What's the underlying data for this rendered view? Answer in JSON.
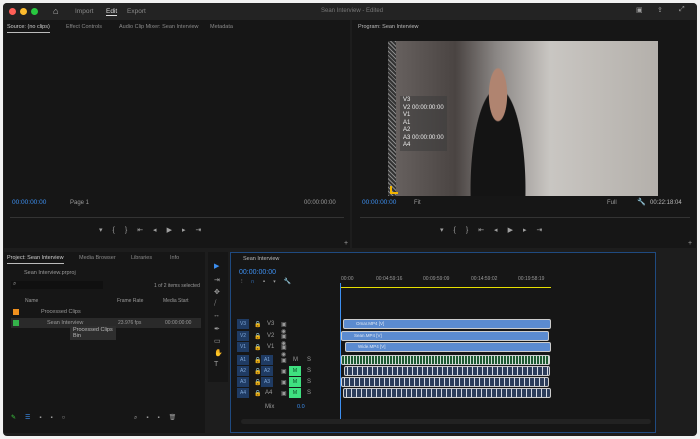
{
  "app": {
    "title": "Sean Interview - Edited",
    "nav": [
      "Import",
      "Edit",
      "Export"
    ],
    "active_nav": "Edit"
  },
  "colors": {
    "accent": "#3d8ff0",
    "close": "#ff5f57",
    "min": "#febc2e",
    "max": "#28c840",
    "mute_on": "#3fe080",
    "video_clip": "#5b8bd0",
    "work_area": "#e6e000"
  },
  "source": {
    "tabs": [
      "Source: (no clips)",
      "Effect Controls",
      "Audio Clip Mixer: Sean Interview",
      "Metadata"
    ],
    "timecode_in": "00:00:00:00",
    "page": "Page 1",
    "timecode_out": "00:00:00:00"
  },
  "program": {
    "tab": "Program: Sean Interview",
    "overlay": [
      "V3",
      "V2 00:00:00:00",
      "V1",
      "A1",
      "A2",
      "A3 00:00:00:00",
      "A4"
    ],
    "timecode": "00:00:00:00",
    "fit": "Fit",
    "quality": "Full",
    "duration": "00:22:18:04"
  },
  "project": {
    "tabs": [
      "Project: Sean Interview",
      "Media Browser",
      "Libraries",
      "Info"
    ],
    "file": "Sean Interview.prproj",
    "selection": "1 of 2 items selected",
    "columns": [
      "Name",
      "Frame Rate",
      "Media Start"
    ],
    "rows": [
      {
        "name": "Processed Clips",
        "color": "#f0901e",
        "frame_rate": "",
        "media_start": ""
      },
      {
        "name": "Sean Interview",
        "color": "#34b24a",
        "frame_rate": "23.976 fps",
        "media_start": "00:00:00:00"
      }
    ],
    "tooltip": [
      "Processed Clips",
      "Bin"
    ]
  },
  "timeline": {
    "tab": "Sean Interview",
    "timecode": "00:00:00:00",
    "ruler": [
      "00:00",
      "00:04:59:16",
      "00:09:59:09",
      "00:14:59:02",
      "00:19:58:19"
    ],
    "video_tracks": [
      {
        "id": "V3",
        "clip": "Omar.MP4 [V]"
      },
      {
        "id": "V2",
        "clip": "Sean.MP4 [V]"
      },
      {
        "id": "V1",
        "clip": "Wide.MP4 [V]"
      }
    ],
    "audio_tracks": [
      {
        "id": "A1",
        "mute": false
      },
      {
        "id": "A2",
        "mute": true
      },
      {
        "id": "A3",
        "mute": true
      },
      {
        "id": "A4",
        "mute": true
      }
    ],
    "mix_label": "Mix",
    "mix_value": "0.0",
    "m": "M",
    "s": "S"
  }
}
